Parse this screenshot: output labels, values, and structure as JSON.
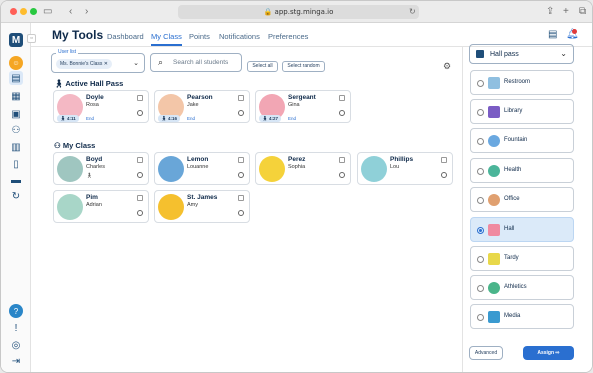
{
  "browser": {
    "url": "app.stg.minga.io"
  },
  "header": {
    "title": "My Tools",
    "tabs": [
      {
        "label": "Dashboard",
        "active": false
      },
      {
        "label": "My Class",
        "active": true
      },
      {
        "label": "Points",
        "active": false
      },
      {
        "label": "Notifications",
        "active": false
      },
      {
        "label": "Preferences",
        "active": false
      }
    ]
  },
  "controls": {
    "user_list_label": "User list",
    "user_list_chip": "Ms. Bonnie's Class",
    "search_placeholder": "Search all students",
    "select_all": "Select all",
    "select_random": "Select random"
  },
  "active_section": {
    "title": "Active Hall Pass",
    "students": [
      {
        "last": "Doyle",
        "first": "Rosa",
        "time": "4:11",
        "end": "End"
      },
      {
        "last": "Pearson",
        "first": "Jake",
        "time": "4:16",
        "end": "End"
      },
      {
        "last": "Sergeant",
        "first": "Gina",
        "time": "4:27",
        "end": "End"
      }
    ]
  },
  "class_section": {
    "title": "My Class",
    "students": [
      {
        "last": "Boyd",
        "first": "Charles"
      },
      {
        "last": "Lemon",
        "first": "Louanne"
      },
      {
        "last": "Perez",
        "first": "Sophia"
      },
      {
        "last": "Phillips",
        "first": "Lou"
      },
      {
        "last": "Pim",
        "first": "Adrian"
      },
      {
        "last": "St. James",
        "first": "Amy"
      }
    ]
  },
  "right_panel": {
    "type_select": "Hall pass",
    "passes": [
      {
        "label": "Restroom",
        "selected": false,
        "color": "#8fbfe0"
      },
      {
        "label": "Library",
        "selected": false,
        "color": "#7a5cc4"
      },
      {
        "label": "Fountain",
        "selected": false,
        "color": "#6aa8e0"
      },
      {
        "label": "Health",
        "selected": false,
        "color": "#4bb59a"
      },
      {
        "label": "Office",
        "selected": false,
        "color": "#e0a070"
      },
      {
        "label": "Hall",
        "selected": true,
        "color": "#f08aa0"
      },
      {
        "label": "Tardy",
        "selected": false,
        "color": "#e8d84a"
      },
      {
        "label": "Athletics",
        "selected": false,
        "color": "#4ab58a"
      },
      {
        "label": "Media",
        "selected": false,
        "color": "#3a9ad0"
      }
    ],
    "advanced": "Advanced",
    "assign": "Assign"
  },
  "accent": "#2a6fd0"
}
